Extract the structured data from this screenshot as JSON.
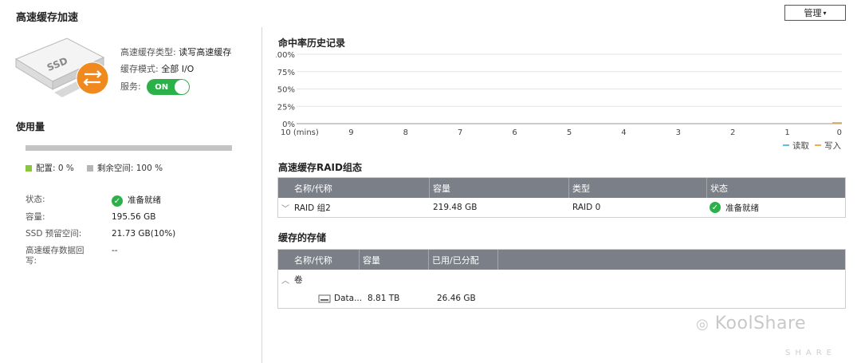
{
  "header": {
    "title": "高速缓存加速",
    "manage_label": "管理",
    "manage_caret": "▾"
  },
  "ssd": {
    "label": "SSD",
    "cache_type_label": "高速缓存类型:",
    "cache_type_value": "读写高速缓存",
    "cache_mode_label": "缓存模式:",
    "cache_mode_value": "全部 I/O",
    "service_label": "服务:",
    "service_state": "ON"
  },
  "usage": {
    "title": "使用量",
    "allocated_label": "配置: 0 %",
    "free_label": "剩余空间: 100 %",
    "allocated_fraction": 0,
    "colors": {
      "allocated": "#8cc63f",
      "free": "#b5b5b5"
    }
  },
  "details": {
    "status_label": "状态:",
    "status_value": "准备就绪",
    "capacity_label": "容量:",
    "capacity_value": "195.56 GB",
    "reserved_label": "SSD 预留空间:",
    "reserved_value": "21.73 GB(10%)",
    "writeback_label": "高速缓存数据回写:",
    "writeback_value": "--"
  },
  "hit_rate": {
    "title": "命中率历史记录"
  },
  "chart_data": {
    "type": "line",
    "title": "命中率历史记录",
    "x": [
      "10 (mins)",
      "9",
      "8",
      "7",
      "6",
      "5",
      "4",
      "3",
      "2",
      "1",
      "0"
    ],
    "y_ticks": [
      "0%",
      "25%",
      "50%",
      "75%",
      "100%"
    ],
    "ylim": [
      0,
      100
    ],
    "grid": true,
    "legend_position": "bottom-right",
    "series": [
      {
        "name": "读取",
        "color": "#5bc0de",
        "values": [
          0,
          0,
          0,
          0,
          0,
          0,
          0,
          0,
          0,
          0,
          0
        ]
      },
      {
        "name": "写入",
        "color": "#f0ad4e",
        "values": [
          0,
          0,
          0,
          0,
          0,
          0,
          0,
          0,
          0,
          0,
          0
        ]
      }
    ]
  },
  "raid": {
    "title": "高速缓存RAID组态",
    "columns": [
      "名称/代称",
      "容量",
      "类型",
      "状态"
    ],
    "rows": [
      {
        "expand": "﹀",
        "name": "RAID 组2",
        "capacity": "219.48 GB",
        "type": "RAID 0",
        "status": "准备就绪"
      }
    ]
  },
  "storage": {
    "title": "缓存的存储",
    "columns": [
      "名称/代称",
      "容量",
      "已用/已分配"
    ],
    "group": {
      "expand": "︿",
      "name": "卷"
    },
    "rows": [
      {
        "name": "Data...",
        "capacity": "8.81 TB",
        "used": "26.46 GB"
      }
    ]
  },
  "watermark": {
    "text": "KoolShare",
    "sub": "SHARE"
  }
}
